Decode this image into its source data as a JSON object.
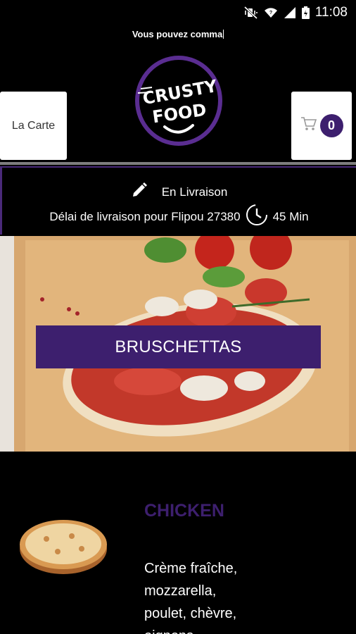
{
  "status_bar": {
    "time": "11:08",
    "icons": [
      "mute-vibrate-icon",
      "wifi-icon",
      "cell-signal-icon",
      "battery-icon"
    ]
  },
  "marquee": {
    "text": "Vous pouvez comma"
  },
  "header": {
    "menu_label": "La Carte",
    "cart_count": "0",
    "logo_text": [
      "CRUSTY",
      "FOOD"
    ]
  },
  "delivery": {
    "mode": "En Livraison",
    "info_prefix": "Délai de livraison pour Flipou 27380",
    "time": "45 Min"
  },
  "banner": {
    "label": "BRUSCHETTAS"
  },
  "product": {
    "name": "CHICKEN",
    "description_lines": [
      "Crème fraîche,",
      "mozzarella,",
      "poulet, chèvre,",
      "oignons"
    ]
  },
  "colors": {
    "accent": "#3d1f6e",
    "background": "#000000",
    "text": "#ffffff"
  }
}
